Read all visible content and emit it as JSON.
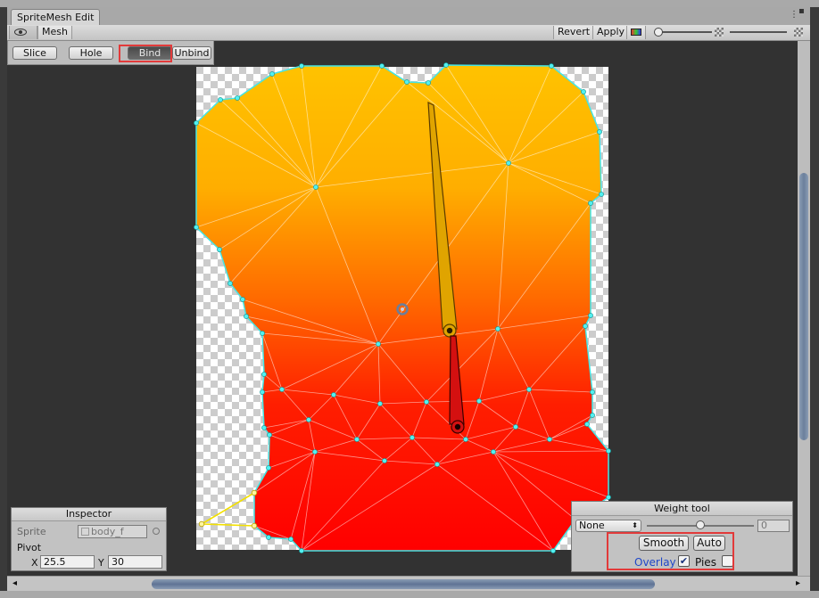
{
  "window": {
    "title": "SpriteMesh Edit"
  },
  "toolbar": {
    "mesh_label": "Mesh",
    "revert_label": "Revert",
    "apply_label": "Apply"
  },
  "modes": {
    "slice": "Slice",
    "hole": "Hole",
    "bind": "Bind",
    "unbind": "Unbind"
  },
  "inspector": {
    "title": "Inspector",
    "sprite_label": "Sprite",
    "sprite_value": "body_f",
    "pivot_label": "Pivot",
    "x_label": "X",
    "x_value": "25.5",
    "y_label": "Y",
    "y_value": "30"
  },
  "weight_tool": {
    "title": "Weight tool",
    "bone_select": "None",
    "slider_value": "0",
    "slider_level": 0.5,
    "smooth_label": "Smooth",
    "auto_label": "Auto",
    "overlay_label": "Overlay",
    "overlay_checked": true,
    "pies_label": "Pies",
    "pies_checked": false
  },
  "colors": {
    "highlight": "#e23a3a",
    "vertex": "#3fe0e0",
    "weight_top": "#ffbf00",
    "weight_bottom": "#ff0000",
    "bone_1": "#e8a800",
    "bone_2": "#d01010",
    "overlay_link": "#1f47c8"
  }
}
